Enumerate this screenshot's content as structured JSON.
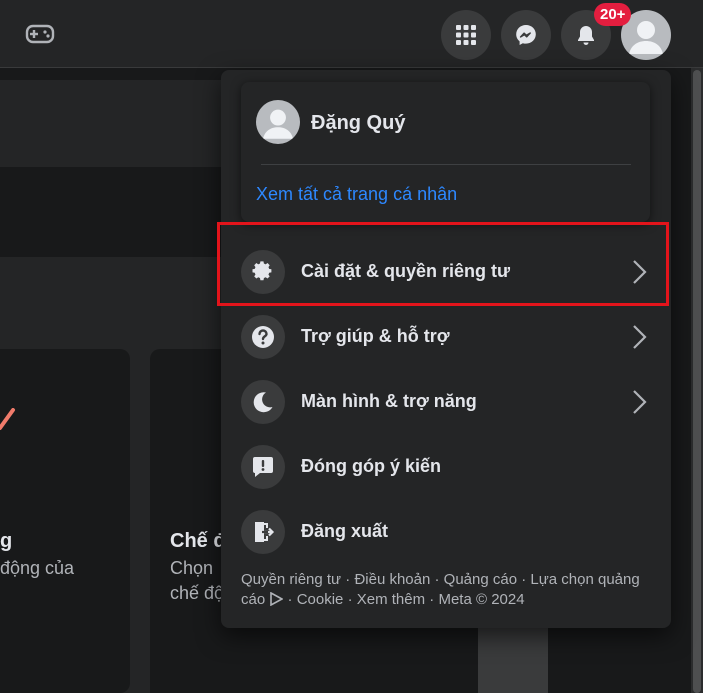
{
  "topbar": {
    "notification_count": "20+",
    "icons": {
      "game": "game-controller-icon",
      "menu": "grid-menu-icon",
      "messenger": "messenger-icon",
      "notifications": "bell-icon",
      "account": "avatar"
    }
  },
  "background": {
    "card_left_text": "g",
    "card_left_sub": "động của",
    "card_mid_title": "Chế đ",
    "card_mid_line1": "Chọn",
    "card_mid_line2": "chế độ"
  },
  "account_menu": {
    "profile_name": "Đặng Quý",
    "see_all_profiles": "Xem tất cả trang cá nhân",
    "items": [
      {
        "label": "Cài đặt & quyền riêng tư",
        "icon": "gear-icon",
        "has_chevron": true,
        "highlighted": true
      },
      {
        "label": "Trợ giúp & hỗ trợ",
        "icon": "question-icon",
        "has_chevron": true
      },
      {
        "label": "Màn hình & trợ năng",
        "icon": "moon-icon",
        "has_chevron": true
      },
      {
        "label": "Đóng góp ý kiến",
        "icon": "feedback-icon",
        "has_chevron": false
      },
      {
        "label": "Đăng xuất",
        "icon": "logout-icon",
        "has_chevron": false
      }
    ],
    "footer": {
      "links": [
        "Quyền riêng tư",
        "Điều khoản",
        "Quảng cáo",
        "Lựa chọn quảng cáo",
        "Cookie",
        "Xem thêm"
      ],
      "copyright": "Meta © 2024"
    }
  },
  "colors": {
    "background": "#18191a",
    "surface": "#242526",
    "link": "#2d88ff",
    "badge": "#e41e3f",
    "highlight": "#e3141b"
  }
}
